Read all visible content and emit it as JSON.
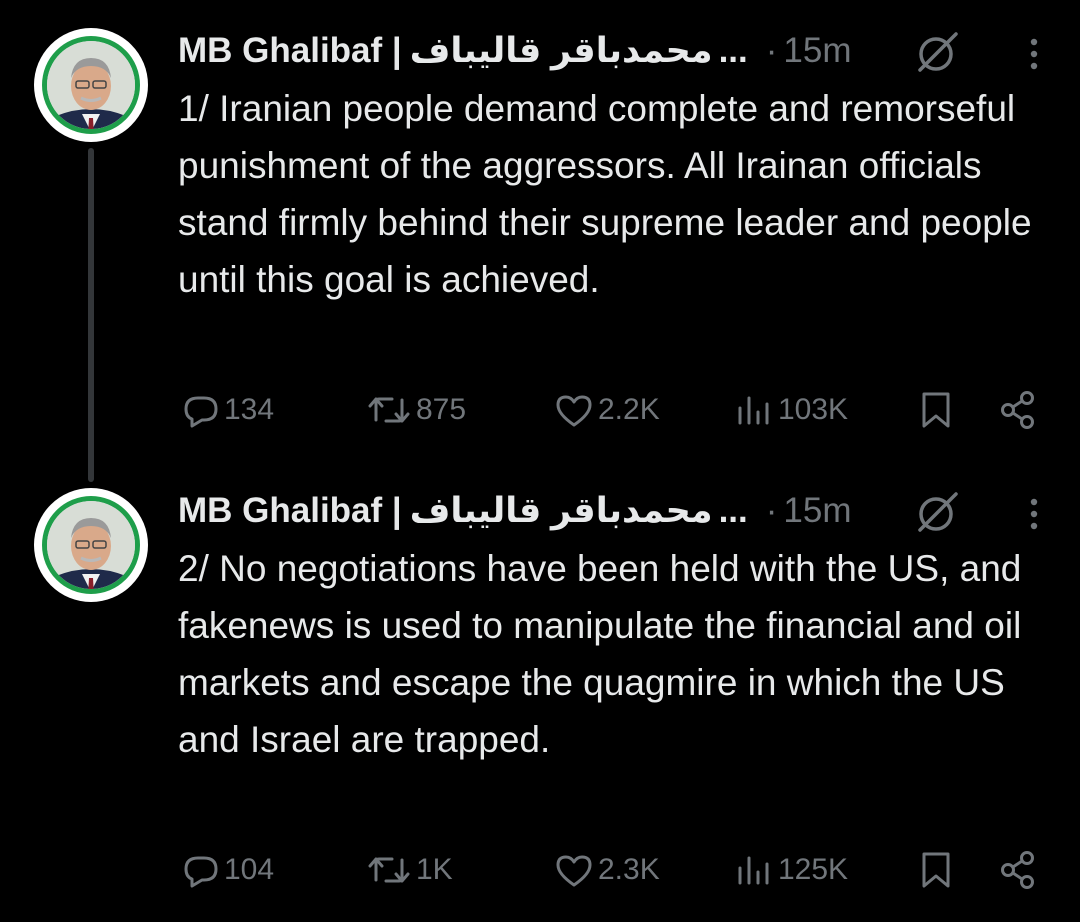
{
  "tweets": [
    {
      "display_name": "MB Ghalibaf |",
      "arabic_name": "محمدباقر قالیباف",
      "ellipsis": "...",
      "dot": "·",
      "time": "15m",
      "text": "1/ Iranian people demand complete and remorseful punishment of the aggressors. All Irainan officials stand firmly behind their supreme leader and people until this goal is achieved.",
      "stats": {
        "replies": "134",
        "reposts": "875",
        "likes": "2.2K",
        "views": "103K"
      }
    },
    {
      "display_name": "MB Ghalibaf |",
      "arabic_name": "محمدباقر قالیباف",
      "ellipsis": "...",
      "dot": "·",
      "time": "15m",
      "text": "2/ No negotiations have been held with the US, and fakenews is used to manipulate the financial and oil markets and escape the quagmire in which the US and Israel are trapped.",
      "stats": {
        "replies": "104",
        "reposts": "1K",
        "likes": "2.3K",
        "views": "125K"
      }
    }
  ],
  "icons": {
    "reply": "reply-icon",
    "repost": "repost-icon",
    "like": "like-icon",
    "views": "views-icon",
    "bookmark": "bookmark-icon",
    "share": "share-icon",
    "grok": "grok-icon",
    "more": "more-icon"
  },
  "colors": {
    "background": "#000000",
    "text": "#e7e9ea",
    "secondary": "#71767b",
    "thread_line": "#333639",
    "avatar_ring": "#1e9e4a"
  }
}
